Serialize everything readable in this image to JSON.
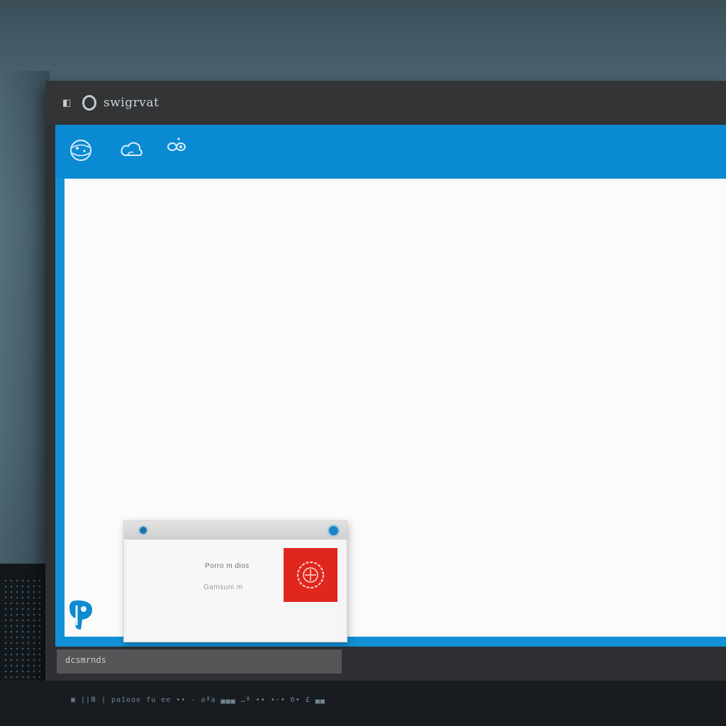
{
  "window": {
    "title": "swigrvat",
    "app_icon": "window-icon"
  },
  "toolbar": {
    "buttons": [
      {
        "icon": "globe-icon"
      },
      {
        "icon": "cloud-icon"
      },
      {
        "icon": "chat-icon"
      }
    ]
  },
  "popup": {
    "line1": "Porro m dios",
    "line2": "Gamsuni m"
  },
  "taskbar": {
    "label": "dcsmrnds"
  },
  "desk": {
    "text": "▣ ||Ⅲ | pаîooe   fu ee  •• · aªа ▄▄▄  …ª   •• •·•   б• £ ▄▄"
  },
  "colors": {
    "accent": "#0a8ad2",
    "alert": "#e0271e",
    "titlebar": "#323436"
  }
}
